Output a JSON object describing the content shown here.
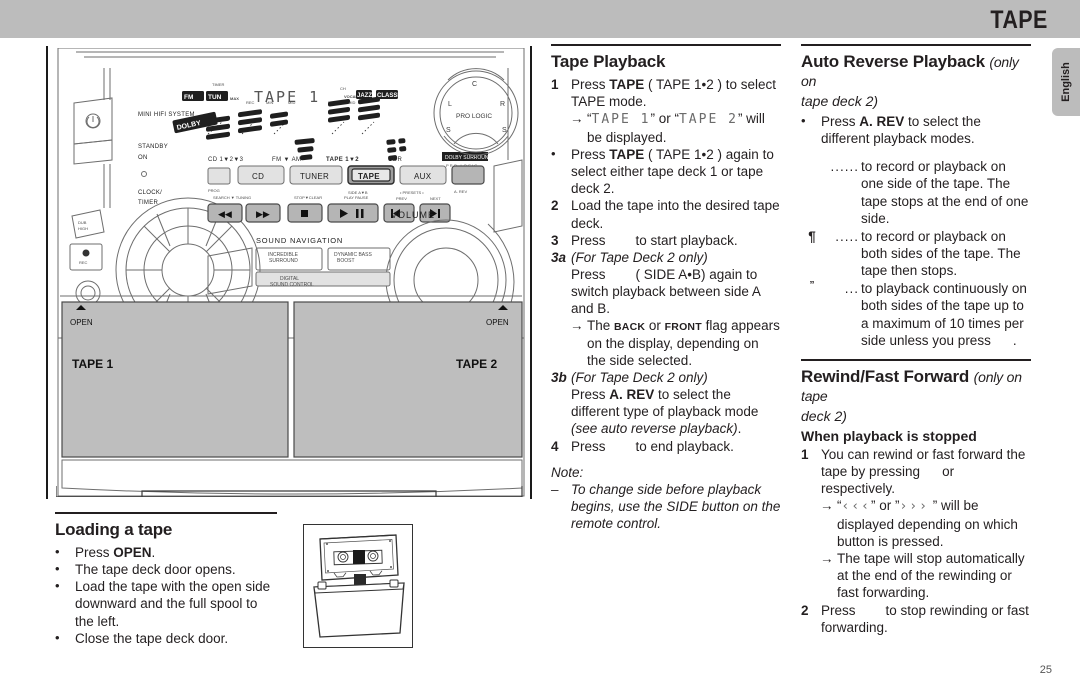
{
  "header": {
    "title": "TAPE",
    "lang_tab": "English"
  },
  "page_number": "25",
  "illustration": {
    "brand_label": "MINI HIFI SYSTEM",
    "standby_label_1": "STANDBY",
    "standby_label_2": "ON",
    "clock_timer_1": "CLOCK/",
    "clock_timer_2": "TIMER",
    "lcd_text": "TAPE  1",
    "lcd_ch": "CH",
    "source_labels": [
      "CD 1 ▼ 2 ▼ 3",
      "FM ▼ AM",
      "TAPE 1 ▼ 2",
      "CDR"
    ],
    "source_buttons": [
      "CD",
      "TUNER",
      "TAPE",
      "AUX"
    ],
    "selected_source": "TAPE",
    "transport_labels": [
      "SEARCH ▼ TUNING",
      "STOP•CLEAR",
      "PLAY  PAUSE",
      "PREV",
      "NEXT"
    ],
    "side_ab_label": "SIDE A▼B",
    "presets_label": "• PRESETS •",
    "a_rev_label": "A. REV",
    "prog_label": "PROG",
    "sound_nav_label": "SOUND NAVIGATION",
    "incredible_surround": "INCREDIBLE\nSURROUND",
    "dynamic_bass": "DYNAMIC BASS\nBOOST",
    "digital_sound_control": "DIGITAL\nSOUND CONTROL",
    "volume_label": "VOLUME",
    "pro_logic_label": "PRO LOGIC",
    "pro_logic_badge_1": "DOLBY SURROUND",
    "pro_logic_badge_2": "P R O • L O G I C",
    "pro_logic_positions": [
      "C",
      "L",
      "R",
      "S",
      "S"
    ],
    "dubbing_label": "DUB\nHIGH",
    "rec_label": "REC",
    "open_label_left": "OPEN",
    "open_label_right": "OPEN",
    "tape1_label": "TAPE 1",
    "tape2_label": "TAPE 2"
  },
  "tape_playback": {
    "heading": "Tape Playback",
    "items": [
      {
        "marker": "1",
        "text_before": "Press ",
        "bold": "TAPE",
        "text_after": " ( TAPE 1•2 ) to select TAPE mode."
      }
    ],
    "step1_pre": "Press ",
    "step1_bold": "TAPE",
    "step1_post": " ( TAPE 1•2 ) to select TAPE mode.",
    "step1_arrow_pre": "“",
    "step1_lcd_a": "TAPE  1",
    "step1_arrow_mid": "” or “",
    "step1_lcd_b": "TAPE  2",
    "step1_arrow_post": "” will be displayed.",
    "bullet1_pre": "Press ",
    "bullet1_bold": "TAPE",
    "bullet1_post": " ( TAPE 1•2 ) again to select either tape deck 1 or tape deck 2.",
    "step2": "Load the tape into the desired tape deck.",
    "step3_pre": "Press",
    "step3_post": "to start playback.",
    "step3a_marker": "3a",
    "step3a_title": "(For Tape Deck 2 only)",
    "step3a_pre": "Press",
    "step3a_post": "( SIDE A•B) again to switch playback between side A and B.",
    "step3a_arrow_pre": "The ",
    "step3a_flag1": "BACK",
    "step3a_arrow_mid": " or ",
    "step3a_flag2": "FRONT",
    "step3a_arrow_post": " flag appears on the display, depending on the side selected.",
    "step3b_marker": "3b",
    "step3b_title": "(For Tape Deck 2 only)",
    "step3b_pre": "Press ",
    "step3b_bold": "A. REV",
    "step3b_post": " to select the different type of playback mode ",
    "step3b_ital": "(see auto reverse playback)",
    "step3b_end": ".",
    "step4_pre": "Press",
    "step4_post": "to end playback.",
    "note_title": "Note:",
    "note_marker": "–",
    "note_text": "To change side before playback begins, use the SIDE button on the remote control."
  },
  "auto_reverse": {
    "heading": "Auto Reverse Playback",
    "heading_qual": "(only on",
    "heading_qual2": "tape deck 2)",
    "bullet_pre": "Press ",
    "bullet_bold": "A. REV",
    "bullet_post": " to select the different playback modes.",
    "modes": [
      {
        "symbol": "",
        "dots": "......",
        "text": "to record or playback on one side of the tape. The tape stops at the end of one side."
      },
      {
        "symbol": "¶",
        "dots": ".....",
        "text": "to record or playback on both sides of the tape. The tape then stops."
      },
      {
        "symbol": "”",
        "dots": "...",
        "text": "to playback continuously on both sides of the tape up to a maximum of 10 times per side unless you press"
      }
    ],
    "modes_tail": "."
  },
  "rewind_ff": {
    "heading": "Rewind/Fast Forward",
    "heading_qual": "(only on tape",
    "heading_qual2": "deck 2)",
    "subheading": "When playback is stopped",
    "step1_pre": "You can rewind or fast forward the tape by pressing",
    "step1_mid": "or",
    "step1_post": "respectively.",
    "arrow1_pre": "“",
    "arrow1_sym1": "‹‹‹",
    "arrow1_mid": "” or ”",
    "arrow1_sym2": "›››",
    "arrow1_post": " ” will be displayed depending on which button is pressed.",
    "arrow2": "The tape will stop automatically at the end of the rewinding or fast forwarding.",
    "step2_pre": "Press",
    "step2_post": "to stop rewinding or fast forwarding."
  },
  "loading_tape": {
    "heading": "Loading a tape",
    "bullets": [
      {
        "pre": "Press ",
        "bold": "OPEN",
        "post": "."
      },
      {
        "pre": "The tape deck door opens.",
        "bold": "",
        "post": ""
      },
      {
        "pre": "Load the tape with the open side downward and the full spool to the left.",
        "bold": "",
        "post": ""
      },
      {
        "pre": "Close the tape deck door.",
        "bold": "",
        "post": ""
      }
    ]
  }
}
